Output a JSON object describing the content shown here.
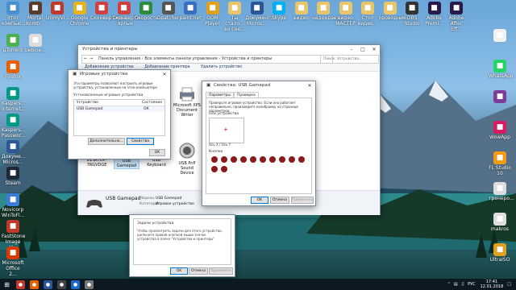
{
  "desktop": {
    "top_icons": [
      {
        "label": "Этот компью...",
        "icon": "computer-icon",
        "color": "#4a8fd0"
      },
      {
        "label": "Mortal Komb...",
        "icon": "game-icon",
        "color": "#5a3a2a"
      },
      {
        "label": "UnmyVi...",
        "icon": "video-icon",
        "color": "#c0392b"
      },
      {
        "label": "Google Chrome",
        "icon": "chrome-icon",
        "color": "#e8b21c"
      },
      {
        "label": "Сконвертир...",
        "icon": "convert-icon",
        "color": "#d04040"
      },
      {
        "label": "Сконверти... - ярлык",
        "icon": "shortcut-icon",
        "color": "#d04040"
      },
      {
        "label": "Скорость ...",
        "icon": "speed-icon",
        "color": "#2c8c3c"
      },
      {
        "label": "Gpatcher",
        "icon": "patch-icon",
        "color": "#555555"
      },
      {
        "label": "paint.net",
        "icon": "paint-icon",
        "color": "#3a6fc0"
      },
      {
        "label": "GOM Player",
        "icon": "gom-icon",
        "color": "#e0a020"
      },
      {
        "label": "Ты стало... во сне...",
        "icon": "folder-icon",
        "color": "#e8c46a"
      },
      {
        "label": "Документ... Micros...",
        "icon": "word-icon",
        "color": "#2b5797"
      },
      {
        "label": "Skype",
        "icon": "skype-icon",
        "color": "#00aff0"
      },
      {
        "label": "видео",
        "icon": "folder-icon",
        "color": "#e8c46a"
      },
      {
        "label": "надоедает...",
        "icon": "folder-icon",
        "color": "#e8c46a"
      },
      {
        "label": "видео МАСТЕР",
        "icon": "folder-icon",
        "color": "#e8c46a"
      },
      {
        "label": "Стол видео...",
        "icon": "folder-icon",
        "color": "#e8c46a"
      },
      {
        "label": "проводник...",
        "icon": "folder-icon",
        "color": "#e8c46a"
      },
      {
        "label": "OBS Studio",
        "icon": "obs-icon",
        "color": "#333333"
      },
      {
        "label": "Adobe Premi...",
        "icon": "premiere-icon",
        "color": "#2a1a4a"
      },
      {
        "label": "Adobe After Eff...",
        "icon": "aftereffects-icon",
        "color": "#2a1a4a"
      }
    ],
    "left_icons": [
      {
        "label": "µTorrent",
        "icon": "utorrent-icon",
        "color": "#4caf50"
      },
      {
        "label": "Firefox",
        "icon": "firefox-icon",
        "color": "#e66000"
      },
      {
        "label": "Kaspers... Internet...",
        "icon": "kaspersky-icon",
        "color": "#009982"
      },
      {
        "label": "Kaspers... Passwor...",
        "icon": "kaspersky-icon",
        "color": "#009982"
      },
      {
        "label": "Докуме... Micros...",
        "icon": "word-icon",
        "color": "#2b5797"
      },
      {
        "label": "Steam",
        "icon": "steam-icon",
        "color": "#1b2838"
      },
      {
        "label": "Novicorp WinToFl...",
        "icon": "wintoflash-icon",
        "color": "#3a7bd5"
      },
      {
        "label": "FastStone Image V...",
        "icon": "faststone-icon",
        "color": "#c0392b"
      },
      {
        "label": "Microsoft Office 2...",
        "icon": "office-icon",
        "color": "#d83b01"
      }
    ],
    "left2_icons": [
      {
        "label": "bebloe...",
        "icon": "file-icon",
        "color": "#dddddd"
      }
    ],
    "right_icons": [
      {
        "label": "",
        "icon": "file-icon",
        "color": "#f0f0f0"
      },
      {
        "label": "WhatsApp",
        "icon": "whatsapp-icon",
        "color": "#25d366"
      },
      {
        "label": "",
        "icon": "purple-icon",
        "color": "#7d3c98"
      },
      {
        "label": "WowApp",
        "icon": "wowapp-icon",
        "color": "#d81b60"
      },
      {
        "label": "FL Studio 10",
        "icon": "flstudio-icon",
        "color": "#f39c12"
      },
      {
        "label": "тренеро...",
        "icon": "file-icon",
        "color": "#dddddd"
      },
      {
        "label": "makros",
        "icon": "file-icon",
        "color": "#dddddd"
      },
      {
        "label": "UltraISO",
        "icon": "ultraiso-icon",
        "color": "#e0a020"
      }
    ]
  },
  "devices_window": {
    "title": "Устройства и принтеры",
    "breadcrumb": [
      "Панель управления",
      "Все элементы панели управления",
      "Устройства и принтеры"
    ],
    "search_placeholder": "Поиск: Устройства...",
    "toolbar": [
      "Добавление устройства",
      "Добавление принтера",
      "Удалить устройство"
    ],
    "devices": [
      {
        "label": "Microsoft XPS Document Writer",
        "icon": "printer-icon"
      },
      {
        "label": "DESKTOP-7RGVDGE",
        "icon": "computer-icon"
      },
      {
        "label": "USB Gamepad",
        "icon": "gamepad-icon"
      },
      {
        "label": "USB Keyboard",
        "icon": "keyboard-icon"
      },
      {
        "label": "USB PnP Sound Device",
        "icon": "speaker-icon"
      }
    ],
    "details": {
      "name": "USB Gamepad",
      "model_label": "Модель:",
      "model_value": "USB Gamepad",
      "category_label": "Категория:",
      "category_value": "Игровое устройство"
    }
  },
  "game_controllers": {
    "title": "Игровые устройства",
    "description": "Эти параметры позволяют настроить игровые устройства, установленные на этом компьютере.",
    "list_label": "Установленные игровые устройства",
    "columns": [
      "Устройство",
      "Состояние"
    ],
    "rows": [
      {
        "device": "USB Gamepad",
        "status": "ОК"
      }
    ],
    "advanced": "Дополнительно...",
    "properties": "Свойства",
    "ok": "OK"
  },
  "gamepad_props": {
    "title": "Свойства: USB Gamepad",
    "tabs": [
      "Параметры",
      "Проверка"
    ],
    "active_tab": 1,
    "hint": "Проверьте игровое устройство. Если оно работает неправильно, произведите калибровку на странице параметров.",
    "axes_label": "Оси устройства",
    "axes_caption": "Ось X / Ось Y",
    "buttons_label": "Кнопки",
    "button_count": 12,
    "ok": "OK",
    "cancel": "Отмена",
    "apply": "Применить"
  },
  "bg_dialog": {
    "heading": "Задачи устройства",
    "text": "Чтобы просмотреть задачи для этого устройства, щелкните правой кнопкой мыши значок устройства в папке \"Устройства и принтеры\".",
    "ok": "OK",
    "cancel": "Отмена",
    "apply": "Применить"
  },
  "taskbar": {
    "lang": "РУС",
    "time": "17:41",
    "date": "12.01.2018"
  }
}
